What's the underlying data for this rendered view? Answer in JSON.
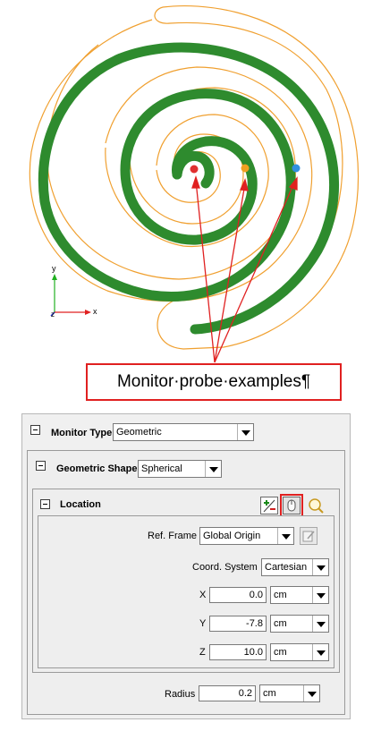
{
  "figure": {
    "callout_text": "Monitor·probe·examples¶",
    "axis_y_label": "y",
    "axis_x_label": "x",
    "axis_z_label": "z",
    "colors": {
      "spiral_green": "#2e8b2e",
      "outline_orange": "#f0a030",
      "arrow_red": "#e02020",
      "probe_red": "#e03030",
      "probe_orange": "#f0a020",
      "probe_blue": "#3090e0"
    }
  },
  "panel": {
    "monitor_type_label": "Monitor Type",
    "monitor_type_value": "Geometric",
    "geometric_shape_label": "Geometric Shape",
    "geometric_shape_value": "Spherical",
    "location_label": "Location",
    "toolbar_icons": [
      "add-remove-icon",
      "mouse-pick-icon",
      "zoom-icon"
    ],
    "ref_frame_label": "Ref. Frame",
    "ref_frame_value": "Global Origin",
    "coord_system_label": "Coord. System",
    "coord_system_value": "Cartesian",
    "x_label": "X",
    "x_value": "0.0",
    "x_unit": "cm",
    "y_label": "Y",
    "y_value": "-7.8",
    "y_unit": "cm",
    "z_label": "Z",
    "z_value": "10.0",
    "z_unit": "cm",
    "radius_label": "Radius",
    "radius_value": "0.2",
    "radius_unit": "cm"
  }
}
